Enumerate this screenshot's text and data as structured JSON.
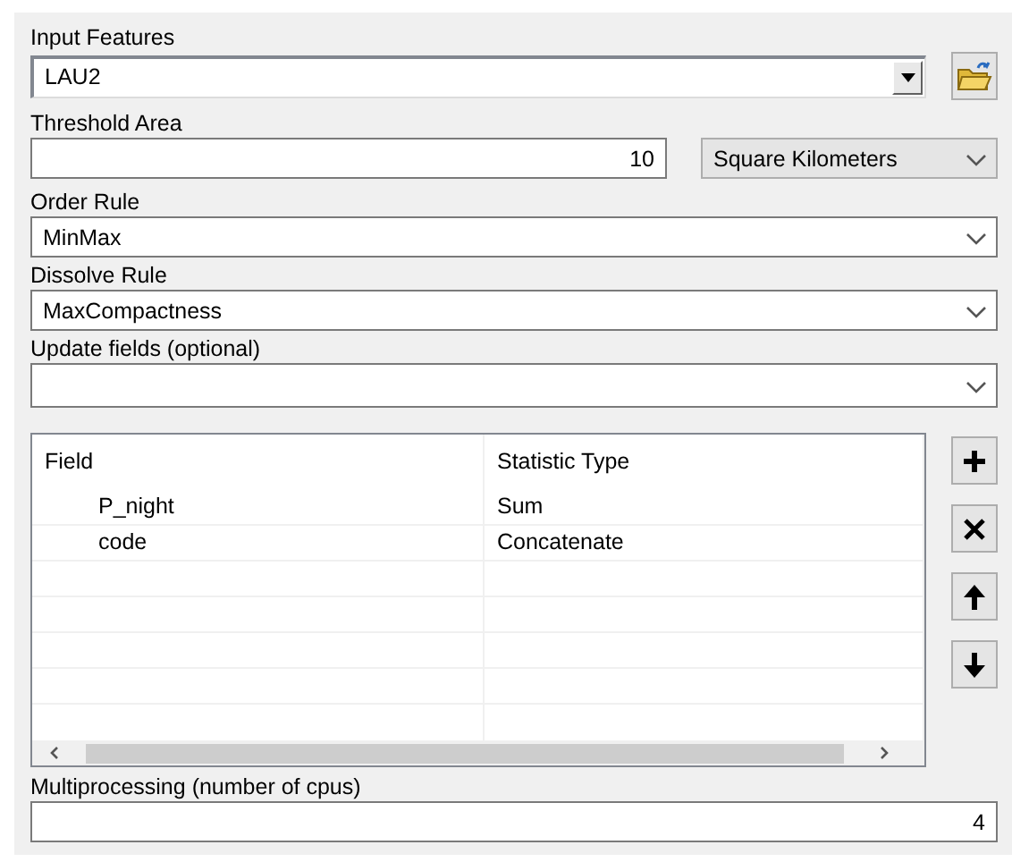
{
  "input_features": {
    "label": "Input Features",
    "value": "LAU2"
  },
  "threshold_area": {
    "label": "Threshold Area",
    "value": "10",
    "unit": "Square Kilometers"
  },
  "order_rule": {
    "label": "Order Rule",
    "value": "MinMax"
  },
  "dissolve_rule": {
    "label": "Dissolve Rule",
    "value": "MaxCompactness"
  },
  "update_fields": {
    "label": "Update fields (optional)"
  },
  "statistics": {
    "columns": [
      "Field",
      "Statistic Type"
    ],
    "rows": [
      {
        "field": "P_night",
        "statistic": "Sum"
      },
      {
        "field": "code",
        "statistic": "Concatenate"
      }
    ],
    "buttons": [
      {
        "kind": "add"
      },
      {
        "kind": "remove"
      },
      {
        "kind": "up"
      },
      {
        "kind": "down"
      }
    ]
  },
  "multiprocessing": {
    "label": "Multiprocessing (number of cpus)",
    "value": "4"
  }
}
